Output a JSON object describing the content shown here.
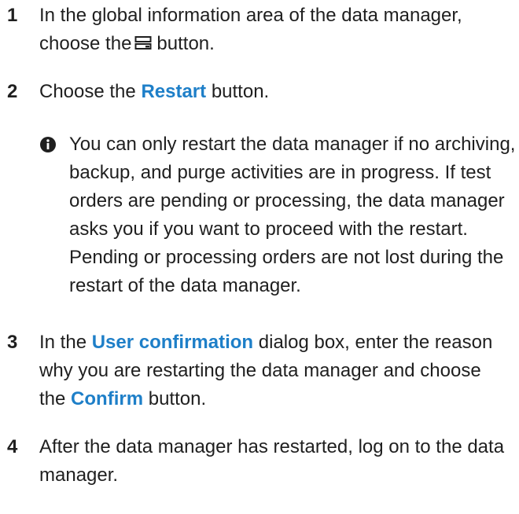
{
  "steps": [
    {
      "number": "1",
      "text_before_icon": "In the global information area of the data manager, choose the",
      "icon": "server-stack-icon",
      "text_after_icon": "button."
    },
    {
      "number": "2",
      "text_before": "Choose the",
      "ui_label": "Restart",
      "text_after": "button."
    },
    {
      "number": "3",
      "text_before": "In the",
      "ui_label_1": "User confirmation",
      "text_middle": "dialog box, enter the reason why you are restarting the data manager and choose the",
      "ui_label_2": "Confirm",
      "text_after": "button."
    },
    {
      "number": "4",
      "text": "After the data manager has restarted, log on to the data manager."
    }
  ],
  "note": {
    "icon": "info-icon",
    "text": "You can only restart the data manager if no archiving, backup, and purge activities are in progress. If test orders are pending or processing, the data manager asks you if you want to proceed with the restart. Pending or processing orders are not lost during the restart of the data manager."
  },
  "colors": {
    "text": "#1f1f1f",
    "ui_label": "#1e7fc8"
  }
}
